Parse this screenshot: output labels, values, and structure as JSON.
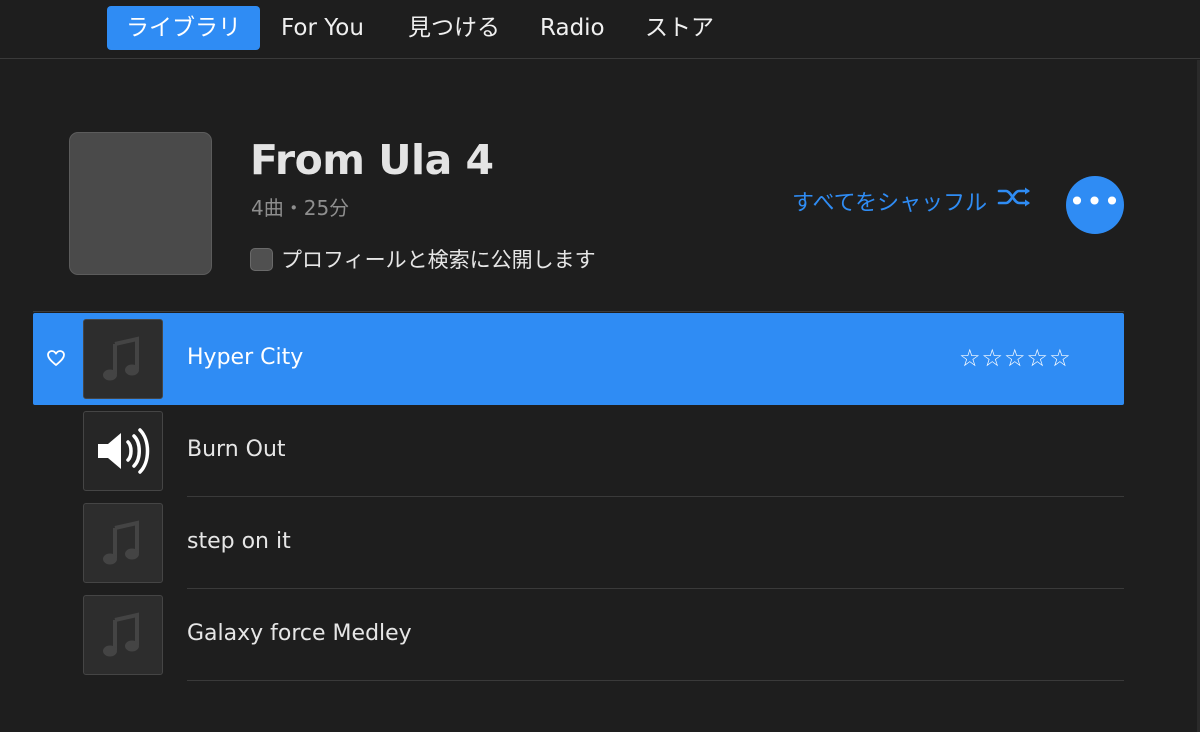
{
  "nav": {
    "tabs": [
      {
        "label": "ライブラリ",
        "active": true
      },
      {
        "label": "For You",
        "active": false
      },
      {
        "label": "見つける",
        "active": false
      },
      {
        "label": "Radio",
        "active": false
      },
      {
        "label": "ストア",
        "active": false
      }
    ]
  },
  "playlist": {
    "title": "From Ula 4",
    "meta": "4曲・25分",
    "publish_label": "プロフィールと検索に公開します",
    "publish_checked": false,
    "shuffle_label": "すべてをシャッフル",
    "shuffle_icon": "shuffle-icon",
    "more_icon": "ellipsis-icon",
    "more_label": "•••"
  },
  "tracks": [
    {
      "title": "Hyper City",
      "selected": true,
      "rating": "☆☆☆☆☆",
      "thumb_icon": "music-note-icon",
      "favorite_icon": "heart-icon"
    },
    {
      "title": "Burn Out",
      "selected": false,
      "playing": true,
      "thumb_icon": "speaker-icon"
    },
    {
      "title": "step on it",
      "selected": false,
      "thumb_icon": "music-note-icon"
    },
    {
      "title": "Galaxy force Medley",
      "selected": false,
      "thumb_icon": "music-note-icon"
    }
  ],
  "colors": {
    "accent": "#2f8cf4",
    "background": "#1e1e1e",
    "divider": "#3a3a3a"
  }
}
